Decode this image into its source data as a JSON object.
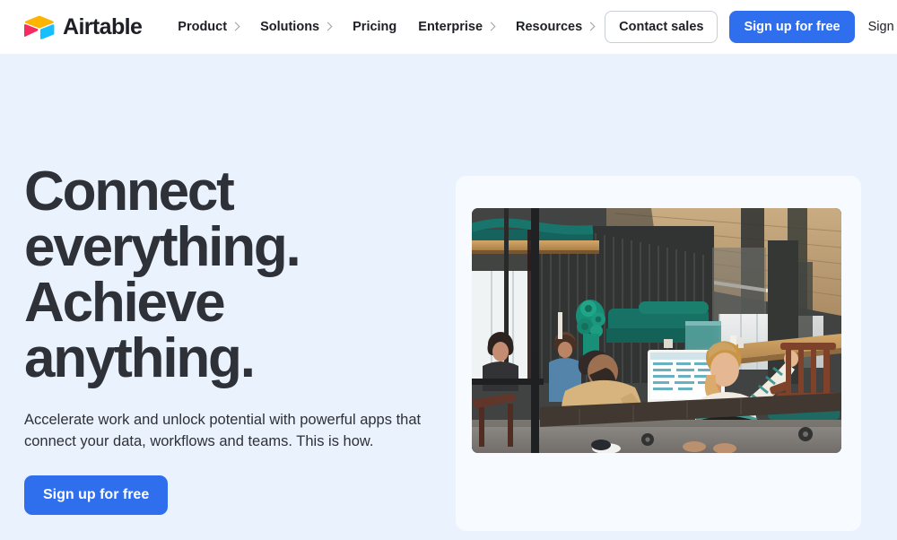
{
  "brand": {
    "name": "Airtable",
    "logo_icon": "airtable-logo-icon",
    "logo_colors": {
      "yellow": "#fcb400",
      "pink": "#f82b60",
      "blue": "#18bfff"
    }
  },
  "header": {
    "nav": [
      {
        "label": "Product",
        "has_chevron": true,
        "icon": "chevron-right-icon"
      },
      {
        "label": "Solutions",
        "has_chevron": true,
        "icon": "chevron-right-icon"
      },
      {
        "label": "Pricing",
        "has_chevron": false,
        "icon": ""
      },
      {
        "label": "Enterprise",
        "has_chevron": true,
        "icon": "chevron-right-icon"
      },
      {
        "label": "Resources",
        "has_chevron": true,
        "icon": "chevron-right-icon"
      }
    ],
    "contact_sales_label": "Contact sales",
    "signup_label": "Sign up for free",
    "signin_label": "Sign in"
  },
  "hero": {
    "title_line1": "Connect",
    "title_line2": "everything.",
    "title_line3": "Achieve",
    "title_line4": "anything.",
    "subtitle": "Accelerate work and unlock potential with powerful apps that connect your data, workflows and teams. This is how.",
    "cta_label": "Sign up for free",
    "image_alt": "People collaborating in a modern open-plan office with an iMac showing an Airtable base"
  },
  "colors": {
    "page_background": "#eaf2fd",
    "header_background": "#ffffff",
    "accent_blue": "#2f6fed",
    "text_dark": "#2e3138",
    "card_background": "#f7fbff"
  }
}
